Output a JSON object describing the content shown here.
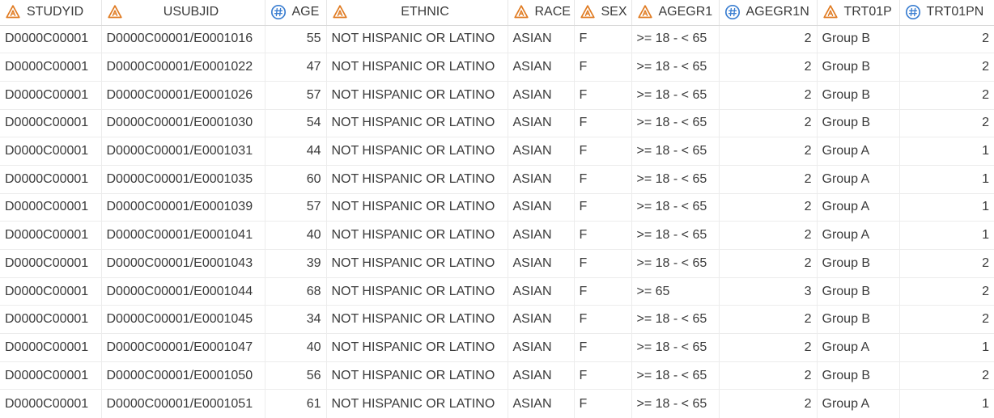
{
  "icons": {
    "char_icon_color": "#e07b22",
    "num_icon_color": "#3c7fd1"
  },
  "columns": [
    {
      "key": "studyid",
      "label": "STUDYID",
      "type": "char",
      "icon": "character-column-icon"
    },
    {
      "key": "usubjid",
      "label": "USUBJID",
      "type": "char",
      "icon": "character-column-icon"
    },
    {
      "key": "age",
      "label": "AGE",
      "type": "num",
      "icon": "numeric-column-icon"
    },
    {
      "key": "ethnic",
      "label": "ETHNIC",
      "type": "char",
      "icon": "character-column-icon"
    },
    {
      "key": "race",
      "label": "RACE",
      "type": "char",
      "icon": "character-column-icon"
    },
    {
      "key": "sex",
      "label": "SEX",
      "type": "char",
      "icon": "character-column-icon"
    },
    {
      "key": "agegr1",
      "label": "AGEGR1",
      "type": "char",
      "icon": "character-column-icon"
    },
    {
      "key": "agegr1n",
      "label": "AGEGR1N",
      "type": "num",
      "icon": "numeric-column-icon"
    },
    {
      "key": "trt01p",
      "label": "TRT01P",
      "type": "char",
      "icon": "character-column-icon"
    },
    {
      "key": "trt01pn",
      "label": "TRT01PN",
      "type": "num",
      "icon": "numeric-column-icon"
    }
  ],
  "rows": [
    [
      "D0000C00001",
      "D0000C00001/E0001016",
      "55",
      "NOT HISPANIC OR LATINO",
      "ASIAN",
      "F",
      ">= 18 - < 65",
      "2",
      "Group B",
      "2"
    ],
    [
      "D0000C00001",
      "D0000C00001/E0001022",
      "47",
      "NOT HISPANIC OR LATINO",
      "ASIAN",
      "F",
      ">= 18 - < 65",
      "2",
      "Group B",
      "2"
    ],
    [
      "D0000C00001",
      "D0000C00001/E0001026",
      "57",
      "NOT HISPANIC OR LATINO",
      "ASIAN",
      "F",
      ">= 18 - < 65",
      "2",
      "Group B",
      "2"
    ],
    [
      "D0000C00001",
      "D0000C00001/E0001030",
      "54",
      "NOT HISPANIC OR LATINO",
      "ASIAN",
      "F",
      ">= 18 - < 65",
      "2",
      "Group B",
      "2"
    ],
    [
      "D0000C00001",
      "D0000C00001/E0001031",
      "44",
      "NOT HISPANIC OR LATINO",
      "ASIAN",
      "F",
      ">= 18 - < 65",
      "2",
      "Group A",
      "1"
    ],
    [
      "D0000C00001",
      "D0000C00001/E0001035",
      "60",
      "NOT HISPANIC OR LATINO",
      "ASIAN",
      "F",
      ">= 18 - < 65",
      "2",
      "Group A",
      "1"
    ],
    [
      "D0000C00001",
      "D0000C00001/E0001039",
      "57",
      "NOT HISPANIC OR LATINO",
      "ASIAN",
      "F",
      ">= 18 - < 65",
      "2",
      "Group A",
      "1"
    ],
    [
      "D0000C00001",
      "D0000C00001/E0001041",
      "40",
      "NOT HISPANIC OR LATINO",
      "ASIAN",
      "F",
      ">= 18 - < 65",
      "2",
      "Group A",
      "1"
    ],
    [
      "D0000C00001",
      "D0000C00001/E0001043",
      "39",
      "NOT HISPANIC OR LATINO",
      "ASIAN",
      "F",
      ">= 18 - < 65",
      "2",
      "Group B",
      "2"
    ],
    [
      "D0000C00001",
      "D0000C00001/E0001044",
      "68",
      "NOT HISPANIC OR LATINO",
      "ASIAN",
      "F",
      ">= 65",
      "3",
      "Group B",
      "2"
    ],
    [
      "D0000C00001",
      "D0000C00001/E0001045",
      "34",
      "NOT HISPANIC OR LATINO",
      "ASIAN",
      "F",
      ">= 18 - < 65",
      "2",
      "Group B",
      "2"
    ],
    [
      "D0000C00001",
      "D0000C00001/E0001047",
      "40",
      "NOT HISPANIC OR LATINO",
      "ASIAN",
      "F",
      ">= 18 - < 65",
      "2",
      "Group A",
      "1"
    ],
    [
      "D0000C00001",
      "D0000C00001/E0001050",
      "56",
      "NOT HISPANIC OR LATINO",
      "ASIAN",
      "F",
      ">= 18 - < 65",
      "2",
      "Group B",
      "2"
    ],
    [
      "D0000C00001",
      "D0000C00001/E0001051",
      "61",
      "NOT HISPANIC OR LATINO",
      "ASIAN",
      "F",
      ">= 18 - < 65",
      "2",
      "Group A",
      "1"
    ]
  ]
}
